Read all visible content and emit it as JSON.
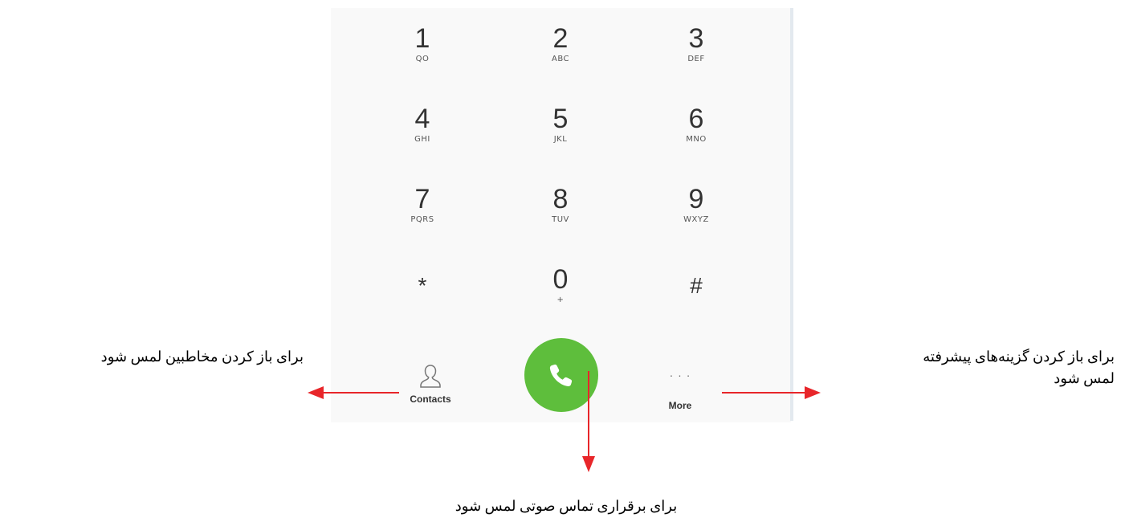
{
  "keypad": [
    {
      "digit": "1",
      "letters": "QO"
    },
    {
      "digit": "2",
      "letters": "ABC"
    },
    {
      "digit": "3",
      "letters": "DEF"
    },
    {
      "digit": "4",
      "letters": "GHI"
    },
    {
      "digit": "5",
      "letters": "JKL"
    },
    {
      "digit": "6",
      "letters": "MNO"
    },
    {
      "digit": "7",
      "letters": "PQRS"
    },
    {
      "digit": "8",
      "letters": "TUV"
    },
    {
      "digit": "9",
      "letters": "WXYZ"
    },
    {
      "digit": "*",
      "letters": ""
    },
    {
      "digit": "0",
      "letters": "+"
    },
    {
      "digit": "#",
      "letters": ""
    }
  ],
  "actions": {
    "contacts_label": "Contacts",
    "more_label": "More",
    "more_dots": "· · ·"
  },
  "annotations": {
    "contacts": "برای باز کردن مخاطبین لمس شود",
    "more_line1": "برای باز کردن گزینه‌های پیشرفته",
    "more_line2": "لمس شود",
    "call": "برای برقراری تماس صوتی لمس شود"
  },
  "colors": {
    "call_green": "#5ebe3c",
    "arrow_red": "#e8262a"
  }
}
